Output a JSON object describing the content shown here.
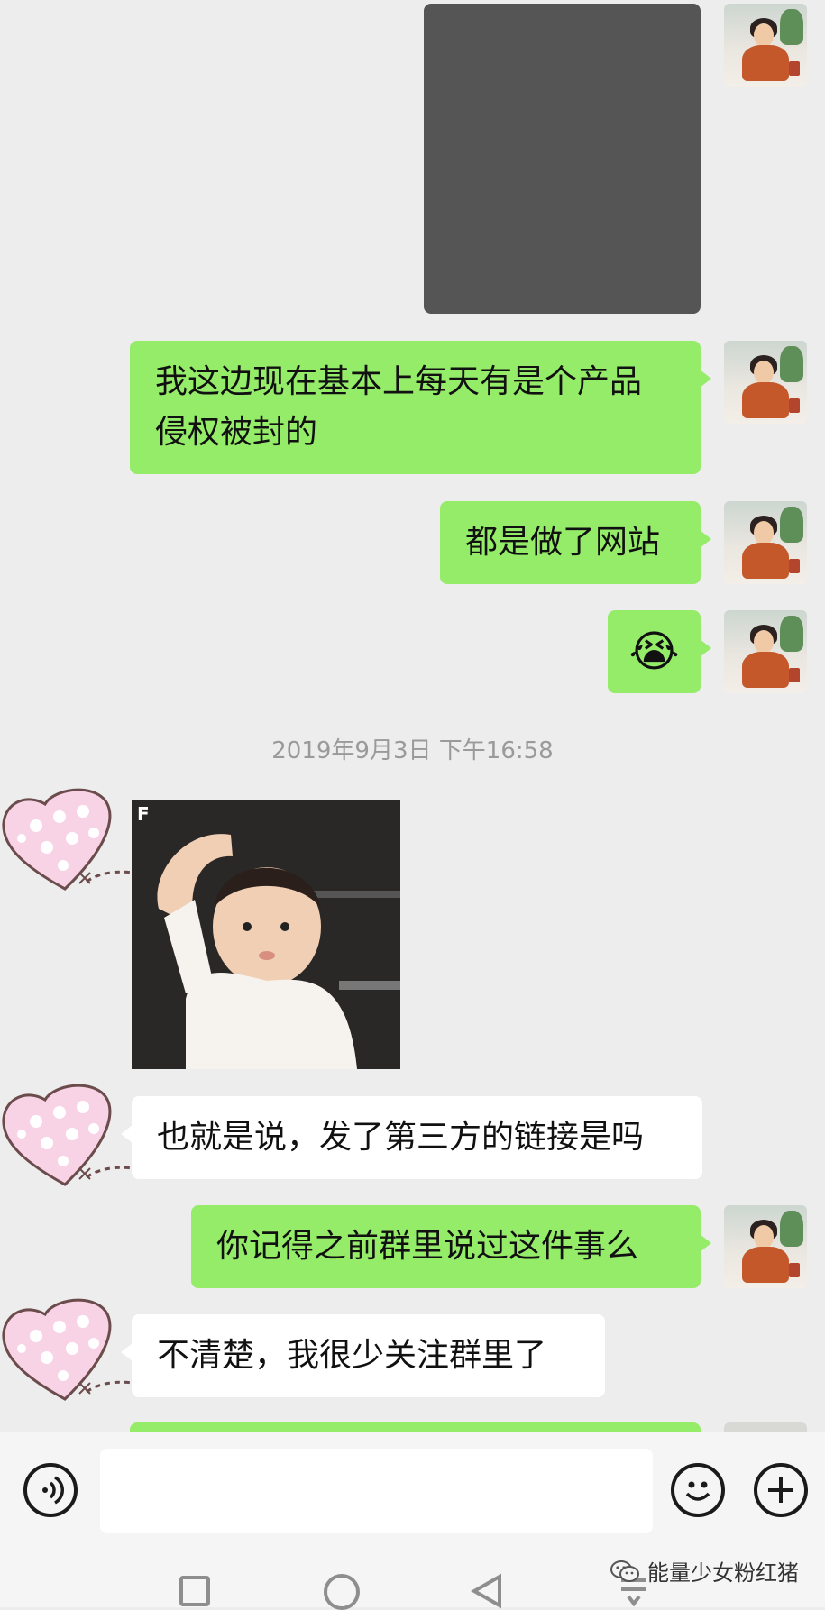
{
  "messages": [
    {
      "id": "m1",
      "side": "right",
      "type": "image"
    },
    {
      "id": "m2",
      "side": "right",
      "type": "text",
      "line1": "我这边现在基本上每天有是个产品",
      "line2": "侵权被封的"
    },
    {
      "id": "m3",
      "side": "right",
      "type": "text",
      "text": "都是做了网站"
    },
    {
      "id": "m4",
      "side": "right",
      "type": "emoji",
      "emoji": "😭"
    },
    {
      "id": "t1",
      "type": "timestamp",
      "text": "2019年9月3日 下午16:58"
    },
    {
      "id": "m5",
      "side": "left",
      "type": "sticker",
      "badge": "F"
    },
    {
      "id": "m6",
      "side": "left",
      "type": "text",
      "text": "也就是说，发了第三方的链接是吗"
    },
    {
      "id": "m7",
      "side": "right",
      "type": "text",
      "text": "你记得之前群里说过这件事么"
    },
    {
      "id": "m8",
      "side": "left",
      "type": "text",
      "text": "不清楚，我很少关注群里了"
    }
  ],
  "input_bar": {
    "voice_icon": "voice-icon",
    "emoji_icon": "smiley-icon",
    "more_icon": "plus-icon"
  },
  "watermark": {
    "text": "能量少女粉红猪",
    "icon": "wechat-icon"
  },
  "colors": {
    "my_bubble": "#95ec69",
    "their_bubble": "#ffffff",
    "background": "#ededed"
  }
}
